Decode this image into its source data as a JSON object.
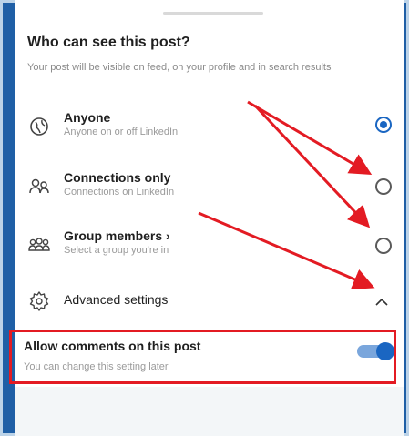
{
  "sheet": {
    "title": "Who can see this post?",
    "subtitle": "Your post will be visible on feed, on your profile and in search results"
  },
  "options": [
    {
      "title": "Anyone",
      "desc": "Anyone on or off LinkedIn",
      "icon": "globe-icon",
      "selected": true
    },
    {
      "title": "Connections only",
      "desc": "Connections on LinkedIn",
      "icon": "connections-icon",
      "selected": false
    },
    {
      "title": "Group members ›",
      "desc": "Select a group you're in",
      "icon": "group-icon",
      "selected": false
    }
  ],
  "advanced": {
    "label": "Advanced settings",
    "icon": "gear-icon",
    "expanded": true
  },
  "comments": {
    "title": "Allow comments on this post",
    "desc": "You can change this setting later",
    "enabled": true
  },
  "colors": {
    "accent": "#1a66c2",
    "annotation": "#e31b23",
    "frame": "#1f5fa6"
  }
}
